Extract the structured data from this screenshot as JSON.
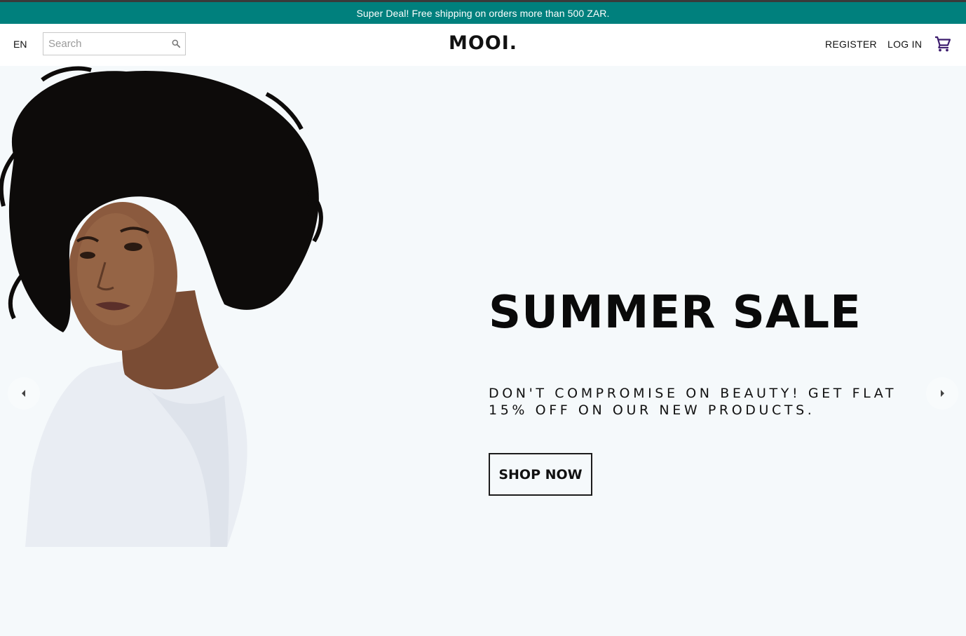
{
  "announcement": {
    "text": "Super Deal! Free shipping on orders more than 500 ZAR.",
    "background": "#00807d"
  },
  "header": {
    "language": "EN",
    "search": {
      "placeholder": "Search",
      "value": ""
    },
    "logo": "MOOI.",
    "register_label": "REGISTER",
    "login_label": "LOG IN",
    "icons": {
      "search": "search-icon",
      "cart": "cart-icon"
    },
    "cart_icon_color": "#3d1d6e"
  },
  "hero": {
    "title": "SUMMER SALE",
    "subtitle": "DON'T COMPROMISE ON BEAUTY! GET FLAT 15% OFF ON OUR NEW PRODUCTS.",
    "button_label": "SHOP NOW",
    "background": "#f5f9fb",
    "icons": {
      "prev": "arrow-left-icon",
      "next": "arrow-right-icon"
    }
  }
}
